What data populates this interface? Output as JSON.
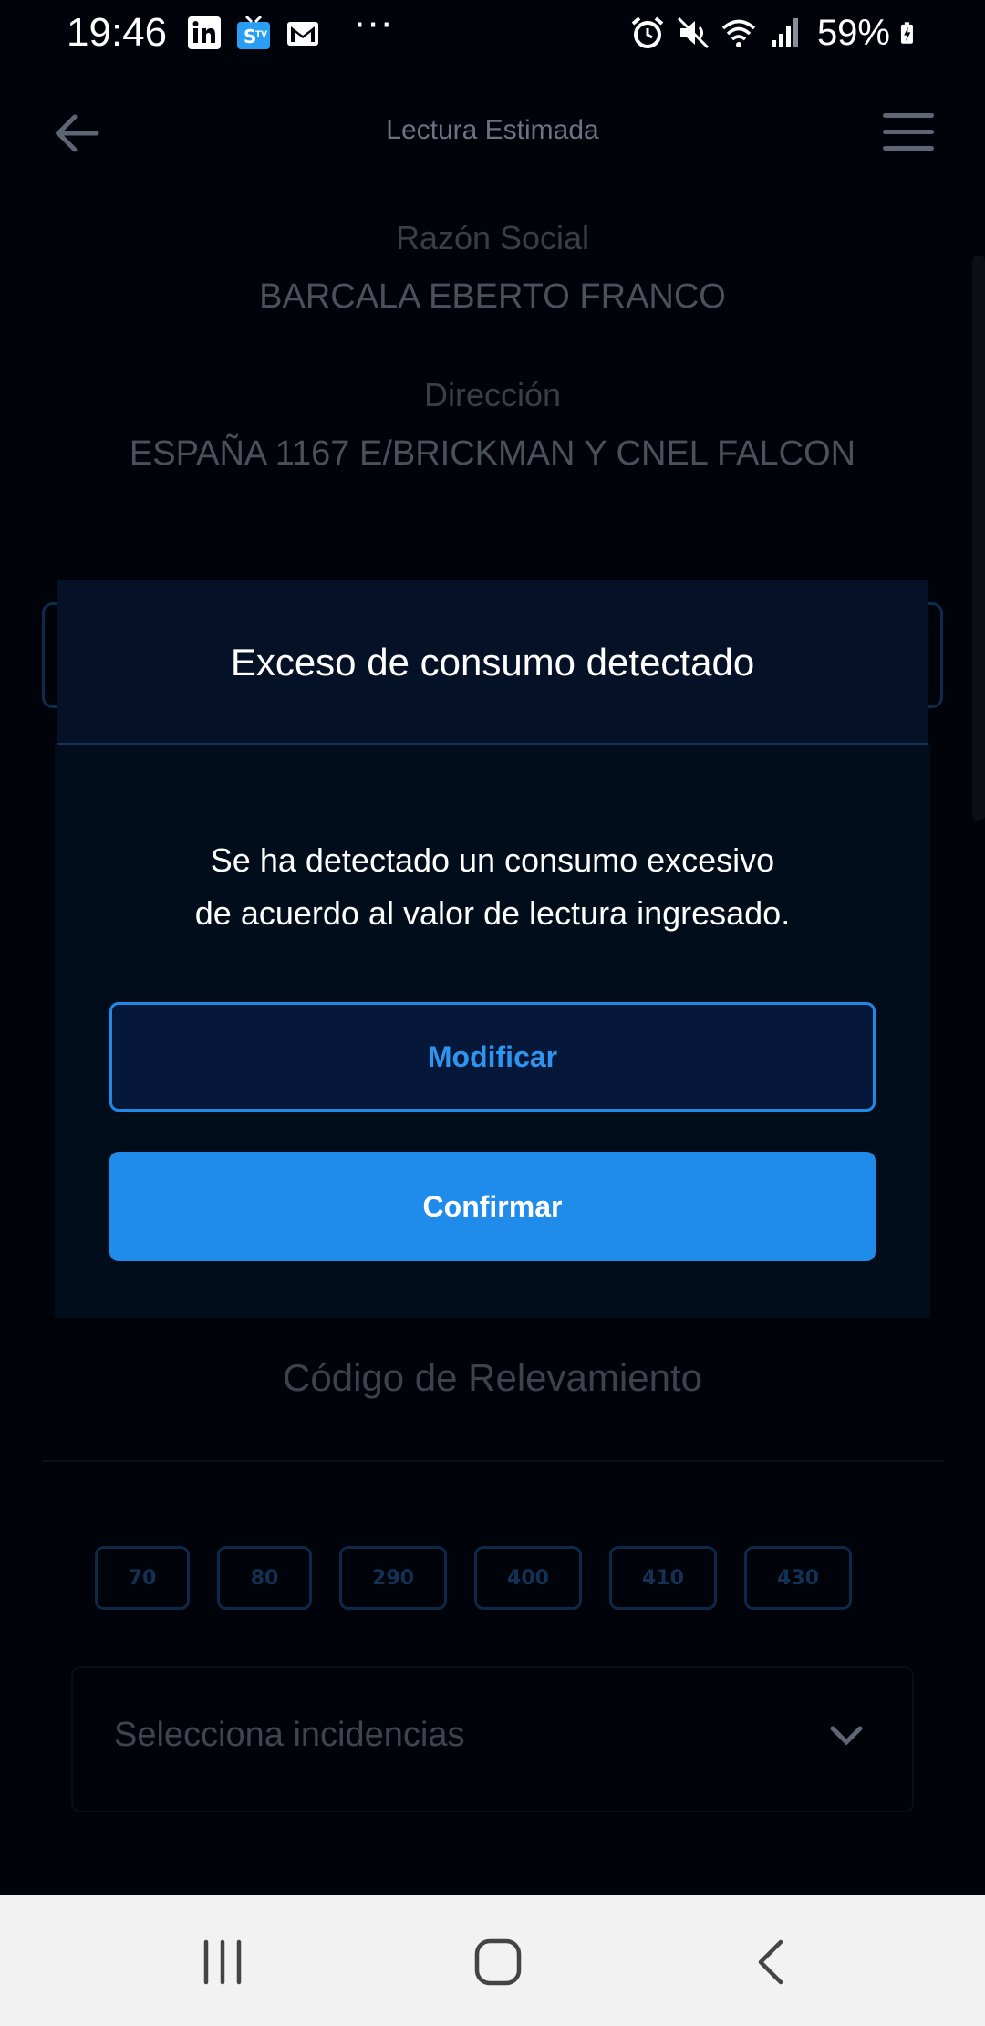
{
  "status_bar": {
    "time": "19:46",
    "app_icons": [
      "linkedin-icon",
      "stv-icon",
      "gmail-icon"
    ],
    "overflow": "···",
    "system_icons": [
      "alarm-icon",
      "mute-icon",
      "wifi-icon",
      "signal-icon",
      "battery-charging-icon"
    ],
    "battery": "59%"
  },
  "app_bar": {
    "title": "Lectura Estimada"
  },
  "background": {
    "razon_social_label": "Razón Social",
    "razon_social_value": "BARCALA EBERTO FRANCO",
    "direccion_label": "Dirección",
    "direccion_value": "ESPAÑA 1167 E/BRICKMAN Y CNEL FALCON",
    "section_title": "Código de Relevamiento",
    "chips": [
      "70",
      "80",
      "290",
      "400",
      "410",
      "430"
    ],
    "incidencias_placeholder": "Selecciona incidencias"
  },
  "dialog": {
    "title": "Exceso de consumo detectado",
    "message_line1": "Se ha detectado un consumo excesivo",
    "message_line2": "de acuerdo al valor de lectura ingresado.",
    "modify_label": "Modificar",
    "confirm_label": "Confirmar"
  },
  "colors": {
    "background": "#000309",
    "dialog_header": "#041126",
    "dialog_body": "#020d1b",
    "accent": "#1f8ceb",
    "nav_bar": "#f2f2f2"
  }
}
